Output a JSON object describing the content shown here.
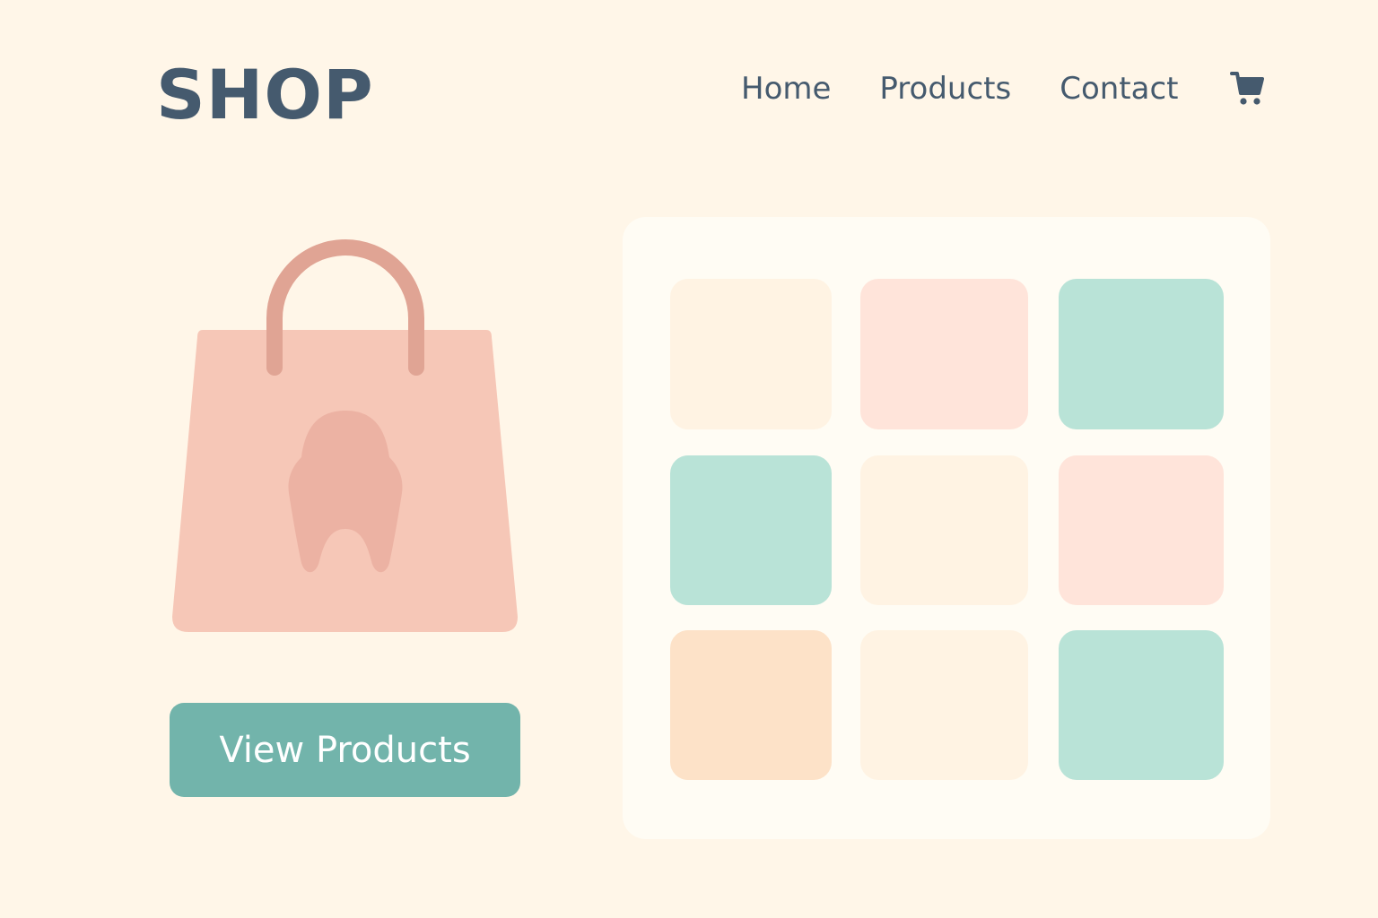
{
  "header": {
    "logo_text": "SHOP",
    "nav": [
      {
        "label": "Home"
      },
      {
        "label": "Products"
      },
      {
        "label": "Contact"
      }
    ],
    "cart_icon": "shopping-cart-icon"
  },
  "hero": {
    "illustration": "shopping-bag-icon",
    "cta_label": "View Products"
  },
  "product_grid": {
    "tiles": [
      {
        "color": "#fff3e3"
      },
      {
        "color": "#ffe4da"
      },
      {
        "color": "#b9e3d7"
      },
      {
        "color": "#b9e3d7"
      },
      {
        "color": "#fff3e3"
      },
      {
        "color": "#ffe4da"
      },
      {
        "color": "#fde2c8"
      },
      {
        "color": "#fff3e3"
      },
      {
        "color": "#b9e3d7"
      }
    ]
  },
  "colors": {
    "background": "#fff6e8",
    "text": "#455a6e",
    "accent": "#72b4ab",
    "bag": "#f6c7b7",
    "bag_handle": "#e0a494"
  }
}
